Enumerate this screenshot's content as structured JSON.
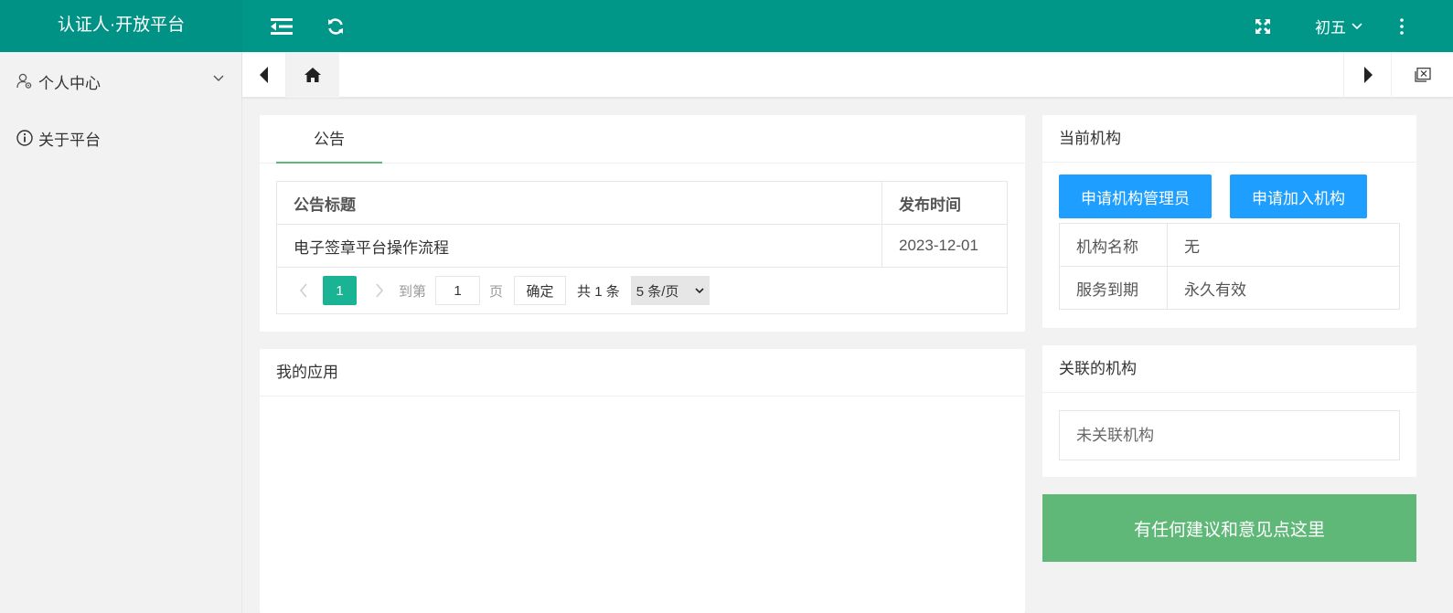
{
  "header": {
    "logo": "认证人·开放平台",
    "user_name": "初五",
    "icons": [
      "menu-fold-icon",
      "refresh-icon",
      "fullscreen-icon",
      "chevron-down-icon",
      "more-vertical-icon"
    ],
    "color": "#009688"
  },
  "sidebar": {
    "items": [
      {
        "label": "个人中心",
        "icon": "user-settings-icon"
      },
      {
        "label": "关于平台",
        "icon": "info-icon"
      }
    ]
  },
  "tabbar": {
    "icons": [
      "prev-tab-icon",
      "home-icon",
      "next-tab-icon",
      "close-tabs-icon"
    ]
  },
  "notice": {
    "tab_label": "公告",
    "columns": [
      "公告标题",
      "发布时间"
    ],
    "rows": [
      {
        "title": "电子签章平台操作流程",
        "date": "2023-12-01"
      }
    ],
    "pager": {
      "current_page": "1",
      "goto_label": "到第",
      "goto_value": "1",
      "page_unit": "页",
      "confirm_label": "确定",
      "total_text": "共 1 条",
      "page_size": "5 条/页"
    }
  },
  "my_apps": {
    "title": "我的应用"
  },
  "current_org": {
    "title": "当前机构",
    "apply_admin_label": "申请机构管理员",
    "apply_join_label": "申请加入机构",
    "rows": [
      {
        "key": "机构名称",
        "value": "无"
      },
      {
        "key": "服务到期",
        "value": "永久有效"
      }
    ]
  },
  "linked_org": {
    "title": "关联的机构",
    "empty_text": "未关联机构"
  },
  "feedback": {
    "label": "有任何建议和意见点这里",
    "color": "#5fb878"
  }
}
